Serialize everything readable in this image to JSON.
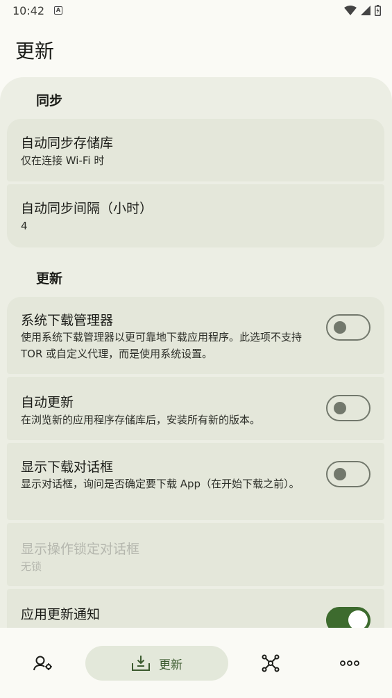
{
  "status_bar": {
    "time": "10:42",
    "notification_glyph": "A"
  },
  "page": {
    "title": "更新"
  },
  "sections": {
    "sync": {
      "header": "同步",
      "auto_sync": {
        "title": "自动同步存储库",
        "summary": "仅在连接 Wi-Fi 时"
      },
      "sync_interval": {
        "title": "自动同步间隔（小时）",
        "summary": "4"
      }
    },
    "updates": {
      "header": "更新",
      "system_downloader": {
        "title": "系统下载管理器",
        "summary": "使用系统下载管理器以更可靠地下载应用程序。此选项不支持 TOR 或自定义代理，而是使用系统设置。",
        "enabled": false
      },
      "auto_update": {
        "title": "自动更新",
        "summary": "在浏览新的应用程序存储库后，安装所有新的版本。",
        "enabled": false
      },
      "download_dialog": {
        "title": "显示下载对话框",
        "summary": "显示对话框，询问是否确定要下载 App（在开始下载之前）。",
        "enabled": false
      },
      "lock_dialog": {
        "title": "显示操作锁定对话框",
        "summary": "无锁",
        "disabled": true
      },
      "update_notifications": {
        "title": "应用更新通知",
        "enabled": true
      }
    }
  },
  "bottom_nav": {
    "items": [
      {
        "icon": "profile-settings-icon"
      },
      {
        "icon": "download-tray-icon",
        "label": "更新",
        "active": true
      },
      {
        "icon": "repositories-graph-icon"
      },
      {
        "icon": "more-dots-icon"
      }
    ]
  },
  "colors": {
    "accent": "#3d6b2e",
    "card": "#e4e7da",
    "panel": "#eceee4",
    "nav_pill": "#e3e8da"
  }
}
